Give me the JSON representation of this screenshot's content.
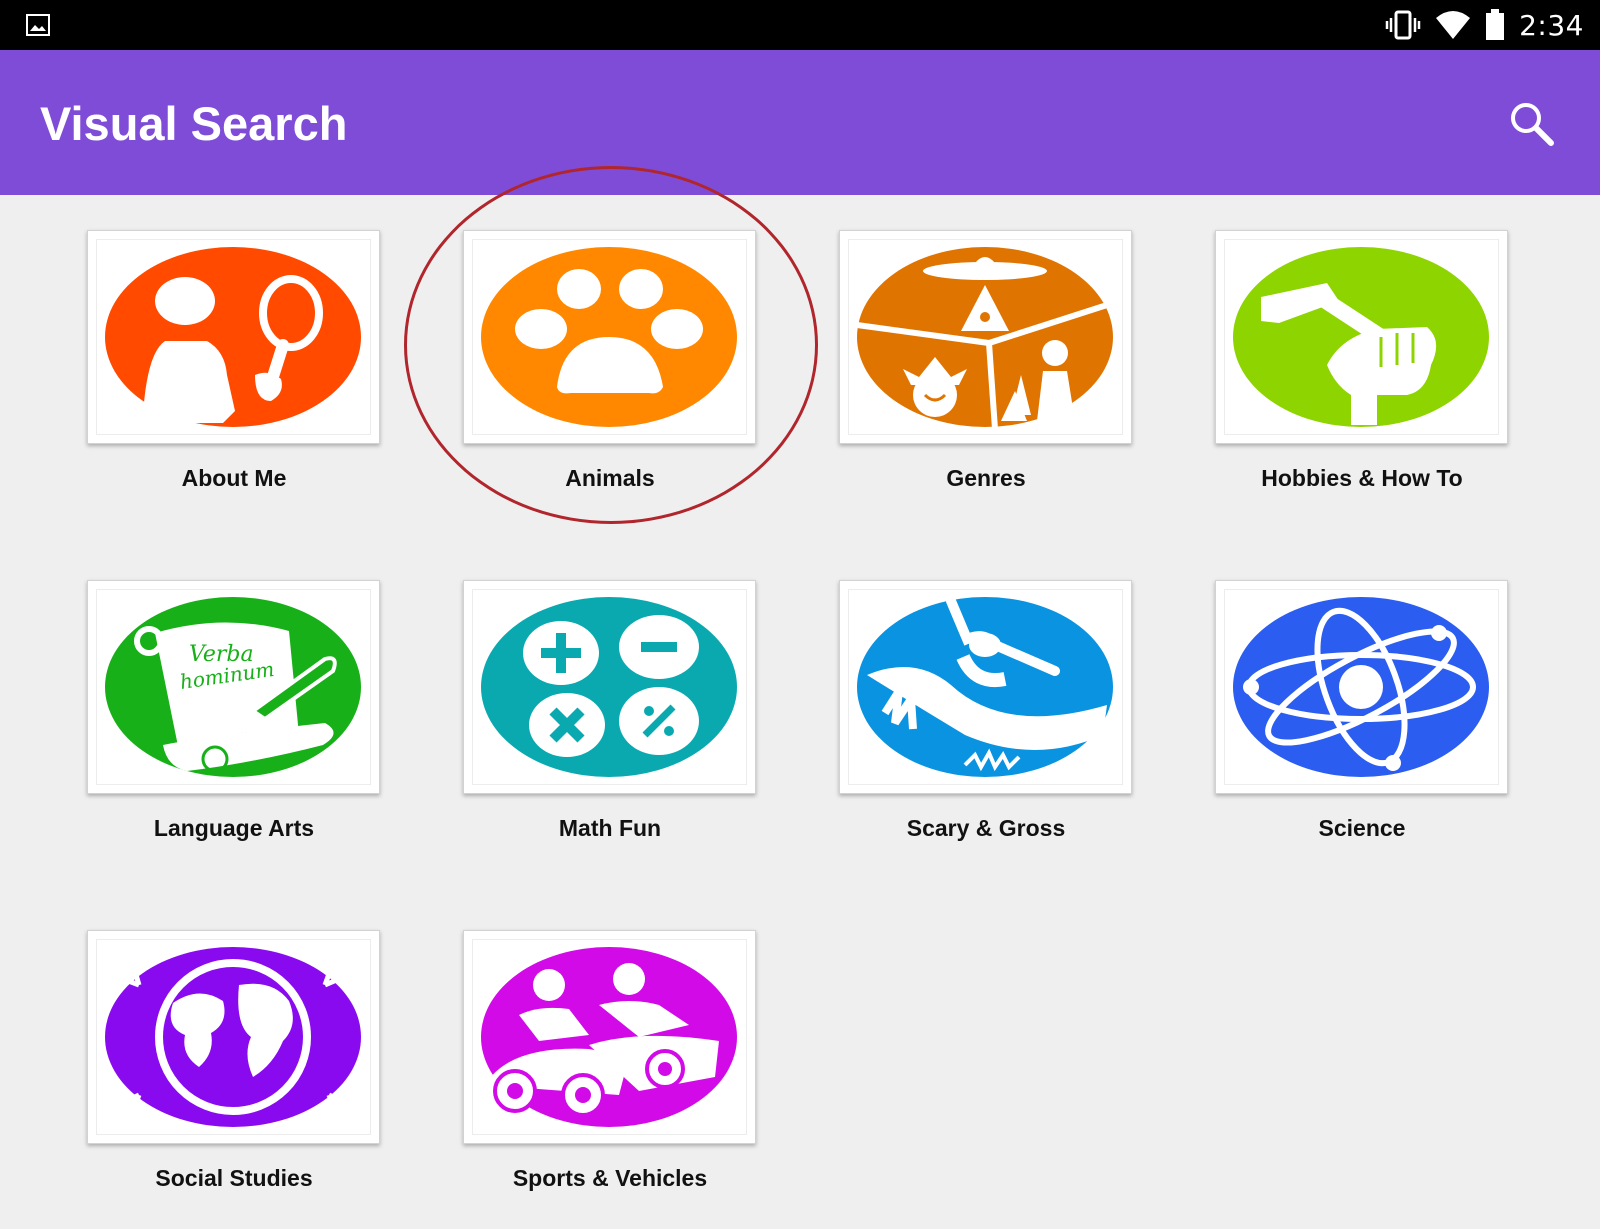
{
  "status_bar": {
    "time": "2:34",
    "icons": [
      "image-notification-icon",
      "vibrate-icon",
      "wifi-icon",
      "battery-icon"
    ]
  },
  "app_bar": {
    "title": "Visual Search",
    "search_icon": "search-icon",
    "color": "#7f4cd8"
  },
  "categories": [
    {
      "label": "About Me",
      "icon": "person-magnifier-icon",
      "color": "#ff4a00"
    },
    {
      "label": "Animals",
      "icon": "paw-icon",
      "color": "#ff8800"
    },
    {
      "label": "Genres",
      "icon": "genres-icon",
      "color": "#e07400"
    },
    {
      "label": "Hobbies & How To",
      "icon": "hammer-fist-icon",
      "color": "#8ed400"
    },
    {
      "label": "Language Arts",
      "icon": "scroll-quill-icon",
      "color": "#18b018",
      "scroll_text_1": "Verba",
      "scroll_text_2": "hominum"
    },
    {
      "label": "Math Fun",
      "icon": "math-symbols-icon",
      "color": "#0aa9b0"
    },
    {
      "label": "Scary & Gross",
      "icon": "slide-creature-icon",
      "color": "#0a93e0"
    },
    {
      "label": "Science",
      "icon": "atom-icon",
      "color": "#2a5df0"
    },
    {
      "label": "Social Studies",
      "icon": "globe-icon",
      "color": "#8a0af0"
    },
    {
      "label": "Sports & Vehicles",
      "icon": "go-kart-icon",
      "color": "#d20ae8"
    }
  ],
  "highlight_ring_color": "#b0262c"
}
